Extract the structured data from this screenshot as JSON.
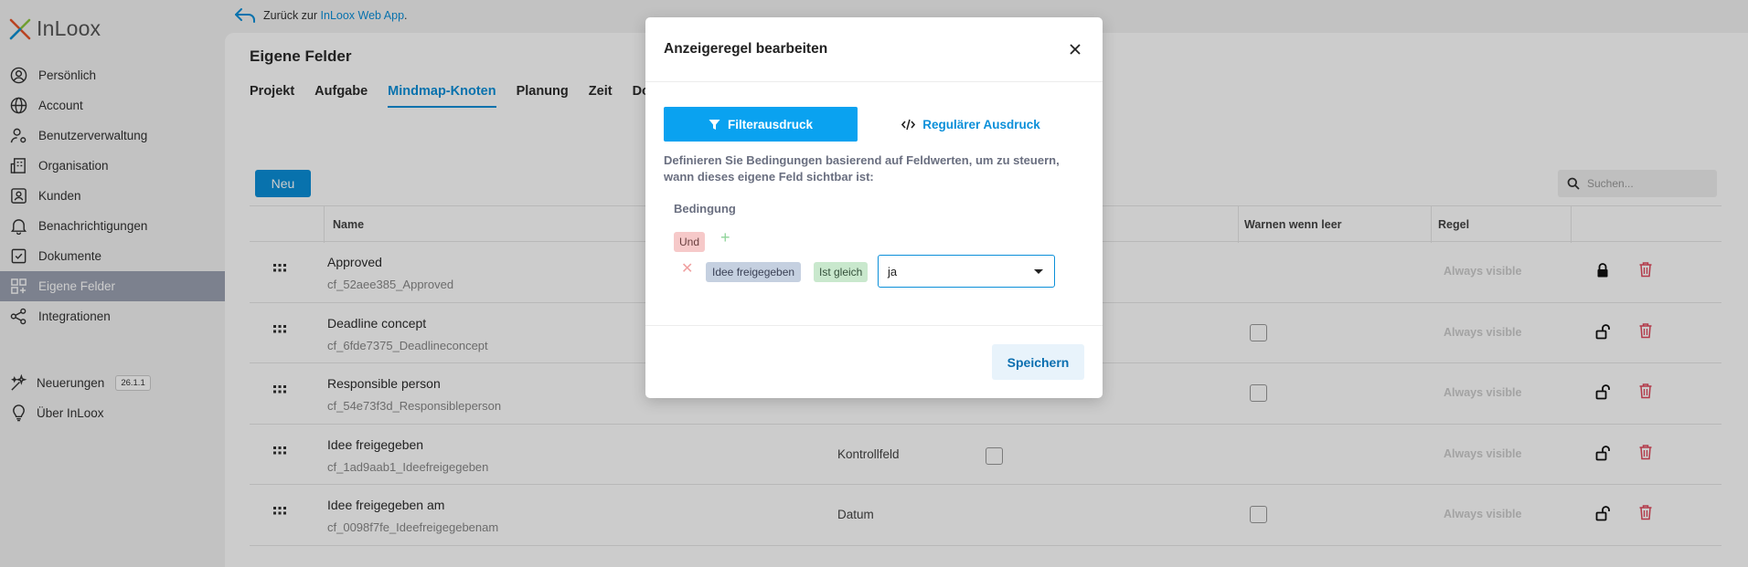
{
  "app": {
    "logo_text": "InLoox"
  },
  "back_link": {
    "prefix": "Zurück zur ",
    "link": "InLoox Web App",
    "suffix": "."
  },
  "sidebar": {
    "items": [
      {
        "label": "Persönlich",
        "icon": "person-icon"
      },
      {
        "label": "Account",
        "icon": "globe-icon"
      },
      {
        "label": "Benutzerverwaltung",
        "icon": "user-gear-icon"
      },
      {
        "label": "Organisation",
        "icon": "building-icon"
      },
      {
        "label": "Kunden",
        "icon": "contact-icon"
      },
      {
        "label": "Benachrichtigungen",
        "icon": "bell-icon"
      },
      {
        "label": "Dokumente",
        "icon": "document-icon"
      },
      {
        "label": "Eigene Felder",
        "icon": "fields-icon",
        "active": true
      },
      {
        "label": "Integrationen",
        "icon": "share-icon"
      }
    ],
    "news": {
      "label": "Neuerungen",
      "version": "26.1.1"
    },
    "about": {
      "label": "Über InLoox"
    }
  },
  "page": {
    "title": "Eigene Felder",
    "tabs": [
      "Projekt",
      "Aufgabe",
      "Mindmap-Knoten",
      "Planung",
      "Zeit",
      "Do"
    ],
    "active_tab": "Mindmap-Knoten",
    "new_button": "Neu",
    "search_placeholder": "Suchen...",
    "columns": {
      "name": "Name",
      "warn": "Warnen wenn leer",
      "rule": "Regel"
    },
    "rows": [
      {
        "name": "Approved",
        "key": "cf_52aee385_Approved",
        "type": "",
        "rule": "Always visible",
        "locked": true,
        "warn_checkbox": false,
        "type_checkbox": false
      },
      {
        "name": "Deadline concept",
        "key": "cf_6fde7375_Deadlineconcept",
        "type": "",
        "rule": "Always visible",
        "locked": false,
        "warn_checkbox": true,
        "type_checkbox": false
      },
      {
        "name": "Responsible person",
        "key": "cf_54e73f3d_Responsibleperson",
        "type": "",
        "rule": "Always visible",
        "locked": false,
        "warn_checkbox": true,
        "type_checkbox": false
      },
      {
        "name": "Idee freigegeben",
        "key": "cf_1ad9aab1_Ideefreigegeben",
        "type": "Kontrollfeld",
        "rule": "Always visible",
        "locked": false,
        "warn_checkbox": false,
        "type_checkbox": true
      },
      {
        "name": "Idee freigegeben am",
        "key": "cf_0098f7fe_Ideefreigegebenam",
        "type": "Datum",
        "rule": "Always visible",
        "locked": false,
        "warn_checkbox": true,
        "type_checkbox": false
      }
    ]
  },
  "modal": {
    "title": "Anzeigeregel bearbeiten",
    "tab_filter": "Filterausdruck",
    "tab_regex": "Regulärer Ausdruck",
    "description": "Definieren Sie Bedingungen basierend auf Feldwerten, um zu steuern, wann dieses eigene Feld sichtbar ist:",
    "condition_label": "Bedingung",
    "group_operator": "Und",
    "condition": {
      "field": "Idee freigegeben",
      "operator": "Ist gleich",
      "value": "ja"
    },
    "save_button": "Speichern"
  },
  "colors": {
    "accent": "#0b8fd9",
    "active_nav": "#9ba2b2",
    "filter_tab": "#0aa2f0",
    "delete": "#e0485c"
  }
}
